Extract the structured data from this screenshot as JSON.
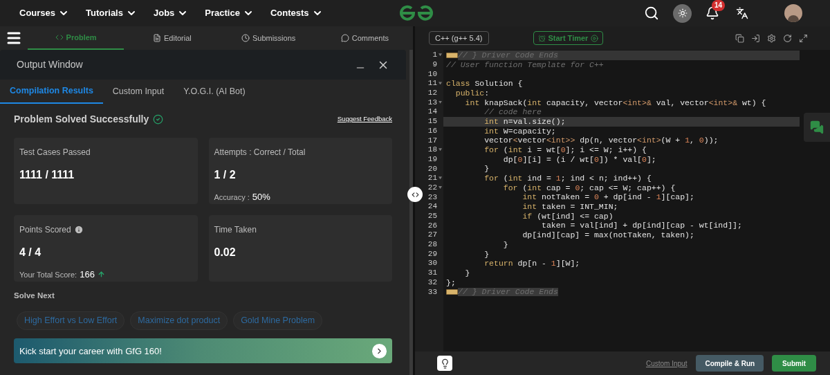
{
  "nav": {
    "menus": [
      "Courses",
      "Tutorials",
      "Jobs",
      "Practice",
      "Contests"
    ],
    "notifications": "14"
  },
  "problem_tabs": [
    {
      "label": "Problem",
      "selected": true,
      "kind": "code"
    },
    {
      "label": "Editorial",
      "selected": false,
      "kind": "doc"
    },
    {
      "label": "Submissions",
      "selected": false,
      "kind": "clock"
    },
    {
      "label": "Comments",
      "selected": false,
      "kind": "chat"
    }
  ],
  "output_window": {
    "title": "Output Window",
    "tabs": [
      {
        "label": "Compilation Results",
        "selected": true
      },
      {
        "label": "Custom Input",
        "selected": false
      },
      {
        "label": "Y.O.G.I. (AI Bot)",
        "selected": false
      }
    ],
    "status": "Problem Solved Successfully",
    "feedback_link": "Suggest Feedback",
    "stats": [
      {
        "label": "Test Cases Passed",
        "value": "1111 / 1111"
      },
      {
        "label": "Attempts : Correct / Total",
        "value": "1 / 2",
        "sub_label": "Accuracy :",
        "sub_value": "50%"
      },
      {
        "label": "Points Scored",
        "value": "4 / 4",
        "info": true,
        "sub_label": "Your Total Score:",
        "sub_value": "166",
        "rising": true
      },
      {
        "label": "Time Taken",
        "value": "0.02"
      }
    ],
    "solve_next": {
      "title": "Solve Next",
      "items": [
        "High Effort vs Low Effort",
        "Maximize dot product",
        "Gold Mine Problem"
      ]
    },
    "banner": "Kick start your career with GfG 160!"
  },
  "editor": {
    "language": "C++ (g++ 5.4)",
    "timer": "Start Timer",
    "lines": [
      {
        "n": "1",
        "fold": true,
        "active": true,
        "folded": true,
        "code": [
          {
            "kind": "comment",
            "text": "// } Driver Code Ends"
          }
        ]
      },
      {
        "n": "9",
        "fold": false,
        "active": false,
        "folded": false,
        "code": [
          {
            "kind": "comment",
            "text": "// User function Template for C++"
          }
        ]
      },
      {
        "n": "10"
      },
      {
        "n": "11",
        "fold": true,
        "active": false,
        "folded": false,
        "code": [
          {
            "kind": "keyword",
            "text": "class"
          },
          {
            "kind": "plain",
            "text": " Solution {"
          }
        ]
      },
      {
        "n": "12",
        "fold": false,
        "active": false,
        "folded": false,
        "code": [
          {
            "kind": "keyword",
            "text": "  public"
          },
          {
            "kind": "plain",
            "text": ":"
          }
        ]
      },
      {
        "n": "13",
        "fold": true,
        "active": false,
        "folded": false,
        "code": [
          {
            "kind": "keyword",
            "text": "    int"
          },
          {
            "kind": "plain",
            "text": " knapSack("
          },
          {
            "kind": "keyword",
            "text": "int"
          },
          {
            "kind": "plain",
            "text": " capacity, vector"
          },
          {
            "kind": "operator",
            "text": "<int>&"
          },
          {
            "kind": "plain",
            "text": " val, vector"
          },
          {
            "kind": "operator",
            "text": "<int>&"
          },
          {
            "kind": "plain",
            "text": " wt) {"
          }
        ]
      },
      {
        "n": "14",
        "fold": false,
        "active": false,
        "folded": false,
        "code": [
          {
            "kind": "comment",
            "text": "        // code here"
          }
        ]
      },
      {
        "n": "15",
        "fold": false,
        "active": true,
        "folded": false,
        "code": [
          {
            "kind": "keyword",
            "text": "        int"
          },
          {
            "kind": "plain",
            "text": " n=val.size();"
          }
        ]
      },
      {
        "n": "16",
        "fold": false,
        "active": false,
        "folded": false,
        "code": [
          {
            "kind": "keyword",
            "text": "        int"
          },
          {
            "kind": "plain",
            "text": " W=capacity;"
          }
        ]
      },
      {
        "n": "17",
        "fold": false,
        "active": false,
        "folded": false,
        "code": [
          {
            "kind": "plain",
            "text": "        vector"
          },
          {
            "kind": "operator",
            "text": "<"
          },
          {
            "kind": "plain",
            "text": "vector"
          },
          {
            "kind": "operator",
            "text": "<int>>"
          },
          {
            "kind": "plain",
            "text": " dp(n, vector"
          },
          {
            "kind": "operator",
            "text": "<int>"
          },
          {
            "kind": "plain",
            "text": "(W + "
          },
          {
            "kind": "number",
            "text": "1"
          },
          {
            "kind": "plain",
            "text": ", "
          },
          {
            "kind": "number",
            "text": "0"
          },
          {
            "kind": "plain",
            "text": "));"
          }
        ]
      },
      {
        "n": "18",
        "fold": true,
        "active": false,
        "folded": false,
        "code": [
          {
            "kind": "keyword",
            "text": "        for"
          },
          {
            "kind": "plain",
            "text": " ("
          },
          {
            "kind": "keyword",
            "text": "int"
          },
          {
            "kind": "plain",
            "text": " i = wt["
          },
          {
            "kind": "number",
            "text": "0"
          },
          {
            "kind": "plain",
            "text": "]; i <= W; i++) {"
          }
        ]
      },
      {
        "n": "19",
        "fold": false,
        "active": false,
        "folded": false,
        "code": [
          {
            "kind": "plain",
            "text": "            dp["
          },
          {
            "kind": "number",
            "text": "0"
          },
          {
            "kind": "plain",
            "text": "][i] = (i / wt["
          },
          {
            "kind": "number",
            "text": "0"
          },
          {
            "kind": "plain",
            "text": "]) * val["
          },
          {
            "kind": "number",
            "text": "0"
          },
          {
            "kind": "plain",
            "text": "];"
          }
        ]
      },
      {
        "n": "20",
        "fold": false,
        "active": false,
        "folded": false,
        "code": [
          {
            "kind": "plain",
            "text": "        }"
          }
        ]
      },
      {
        "n": "21",
        "fold": true,
        "active": false,
        "folded": false,
        "code": [
          {
            "kind": "keyword",
            "text": "        for"
          },
          {
            "kind": "plain",
            "text": " ("
          },
          {
            "kind": "keyword",
            "text": "int"
          },
          {
            "kind": "plain",
            "text": " ind = "
          },
          {
            "kind": "number",
            "text": "1"
          },
          {
            "kind": "plain",
            "text": "; ind < n; ind++) {"
          }
        ]
      },
      {
        "n": "22",
        "fold": true,
        "active": false,
        "folded": false,
        "code": [
          {
            "kind": "keyword",
            "text": "            for"
          },
          {
            "kind": "plain",
            "text": " ("
          },
          {
            "kind": "keyword",
            "text": "int"
          },
          {
            "kind": "plain",
            "text": " cap = "
          },
          {
            "kind": "number",
            "text": "0"
          },
          {
            "kind": "plain",
            "text": "; cap <= W; cap++) {"
          }
        ]
      },
      {
        "n": "23",
        "fold": false,
        "active": false,
        "folded": false,
        "code": [
          {
            "kind": "keyword",
            "text": "                int"
          },
          {
            "kind": "plain",
            "text": " notTaken = "
          },
          {
            "kind": "number",
            "text": "0"
          },
          {
            "kind": "plain",
            "text": " + dp[ind - "
          },
          {
            "kind": "number",
            "text": "1"
          },
          {
            "kind": "plain",
            "text": "][cap];"
          }
        ]
      },
      {
        "n": "24",
        "fold": false,
        "active": false,
        "folded": false,
        "code": [
          {
            "kind": "keyword",
            "text": "                int"
          },
          {
            "kind": "plain",
            "text": " taken = INT_MIN;"
          }
        ]
      },
      {
        "n": "25",
        "fold": false,
        "active": false,
        "folded": false,
        "code": [
          {
            "kind": "keyword",
            "text": "                if"
          },
          {
            "kind": "plain",
            "text": " (wt[ind] <= cap)"
          }
        ]
      },
      {
        "n": "26",
        "fold": false,
        "active": false,
        "folded": false,
        "code": [
          {
            "kind": "plain",
            "text": "                    taken = val[ind] + dp[ind][cap - wt[ind]];"
          }
        ]
      },
      {
        "n": "27",
        "fold": false,
        "active": false,
        "folded": false,
        "code": [
          {
            "kind": "plain",
            "text": "                dp[ind][cap] = max(notTaken, taken);"
          }
        ]
      },
      {
        "n": "28",
        "fold": false,
        "active": false,
        "folded": false,
        "code": [
          {
            "kind": "plain",
            "text": "            }"
          }
        ]
      },
      {
        "n": "29",
        "fold": false,
        "active": false,
        "folded": false,
        "code": [
          {
            "kind": "plain",
            "text": "        }"
          }
        ]
      },
      {
        "n": "30",
        "fold": false,
        "active": false,
        "folded": false,
        "code": [
          {
            "kind": "keyword",
            "text": "        return"
          },
          {
            "kind": "plain",
            "text": " dp[n - "
          },
          {
            "kind": "number",
            "text": "1"
          },
          {
            "kind": "plain",
            "text": "][W];"
          }
        ]
      },
      {
        "n": "31",
        "fold": false,
        "active": false,
        "folded": false,
        "code": [
          {
            "kind": "plain",
            "text": "    }"
          }
        ]
      },
      {
        "n": "32",
        "fold": false,
        "active": false,
        "folded": false,
        "code": [
          {
            "kind": "plain",
            "text": "};"
          }
        ]
      },
      {
        "n": "33",
        "fold": false,
        "active": false,
        "folded": true,
        "code": [
          {
            "kind": "comment",
            "text": "// } Driver Code Ends"
          }
        ]
      }
    ],
    "footer": {
      "custom_input": "Custom Input",
      "compile": "Compile & Run",
      "submit": "Submit"
    }
  }
}
